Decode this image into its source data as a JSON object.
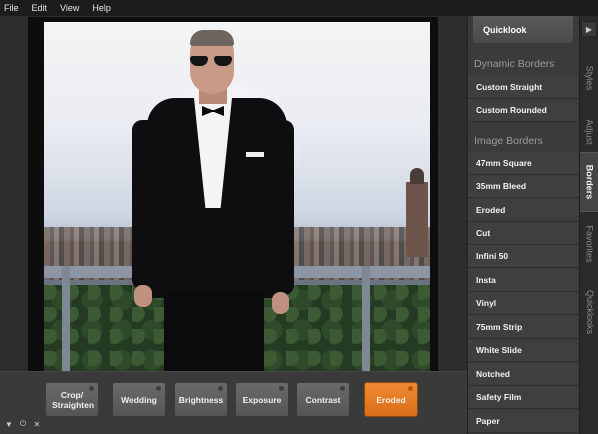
{
  "menubar": {
    "items": [
      "File",
      "Edit",
      "View",
      "Help"
    ]
  },
  "panel": {
    "quicklook_label": "Quicklook",
    "dynamic_borders": {
      "title": "Dynamic Borders",
      "items": [
        "Custom Straight",
        "Custom Rounded"
      ]
    },
    "image_borders": {
      "title": "Image Borders",
      "items": [
        "47mm Square",
        "35mm Bleed",
        "Eroded",
        "Cut",
        "Infini 50",
        "Insta",
        "Vinyl",
        "75mm Strip",
        "White Slide",
        "Notched",
        "Safety Film",
        "Paper"
      ]
    }
  },
  "tabs": {
    "items": [
      "Styles",
      "Adjust",
      "Borders",
      "Favorites",
      "Quicklooks"
    ],
    "active": "Borders"
  },
  "toolbar": {
    "filters": [
      "Crop/ Straighten",
      "Wedding",
      "Brightness",
      "Exposure",
      "Contrast",
      "Eroded"
    ],
    "active_filter": "Eroded"
  },
  "colors": {
    "accent": "#e87b25",
    "panel_bg": "#3b3b3b",
    "canvas_bg": "#2a2a2a"
  },
  "icons": {
    "tab_arrow": "arrow-right-icon",
    "mini_controls": [
      "triangle-down-icon",
      "power-icon",
      "close-icon"
    ]
  }
}
